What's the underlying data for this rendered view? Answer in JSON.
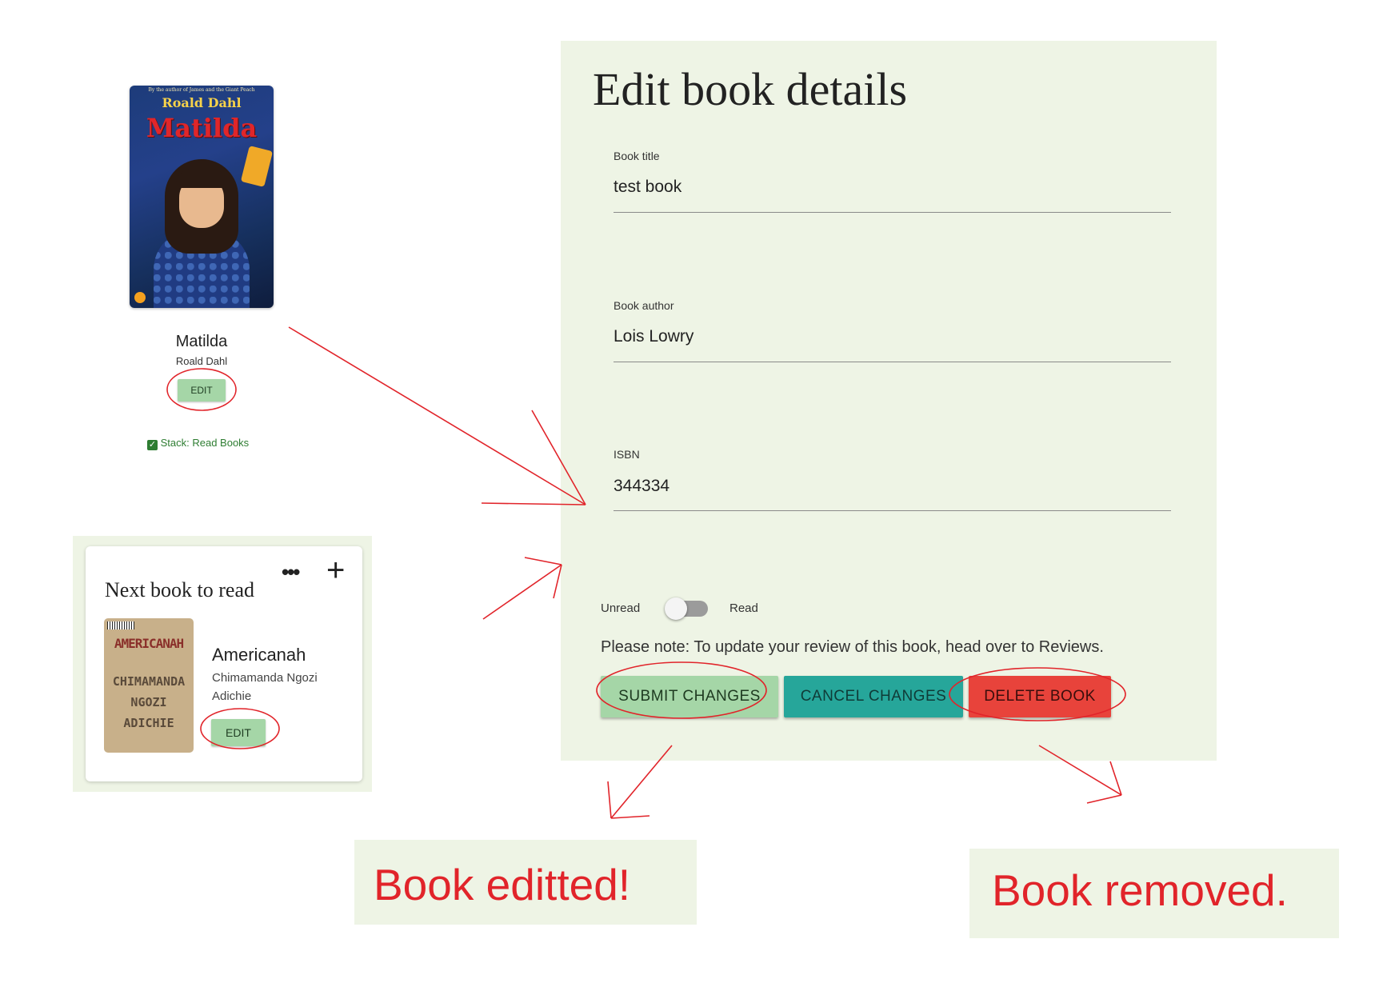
{
  "matilda_card": {
    "cover": {
      "top_text": "By the author of James and the Giant Peach",
      "author": "Roald Dahl",
      "title": "Matilda"
    },
    "title": "Matilda",
    "author": "Roald Dahl",
    "edit_label": "EDIT",
    "stack_label": "Stack: Read Books"
  },
  "next_book": {
    "heading": "Next book to read",
    "more_icon": "•••",
    "add_icon": "+",
    "cover": {
      "title": "AMERICANAH",
      "line1": "CHIMAMANDA",
      "line2": "NGOZI",
      "line3": "ADICHIE"
    },
    "title": "Americanah",
    "author": "Chimamanda Ngozi Adichie",
    "edit_label": "EDIT"
  },
  "edit_form": {
    "heading": "Edit book details",
    "fields": [
      {
        "label": "Book title",
        "value": "test book"
      },
      {
        "label": "Book author",
        "value": "Lois Lowry"
      },
      {
        "label": "ISBN",
        "value": "344334"
      }
    ],
    "toggle": {
      "left_label": "Unread",
      "right_label": "Read",
      "state": "Unread"
    },
    "note": "Please note: To update your review of this book, head over to Reviews.",
    "buttons": {
      "submit": "SUBMIT CHANGES",
      "cancel": "CANCEL CHANGES",
      "delete": "DELETE BOOK"
    }
  },
  "results": {
    "edited": "Book editted!",
    "removed": "Book removed."
  },
  "colors": {
    "panel_bg": "#eef4e5",
    "submit_green": "#a5d6a7",
    "cancel_teal": "#26a69a",
    "delete_red": "#e8433b",
    "annotation_red": "#e1242a"
  }
}
